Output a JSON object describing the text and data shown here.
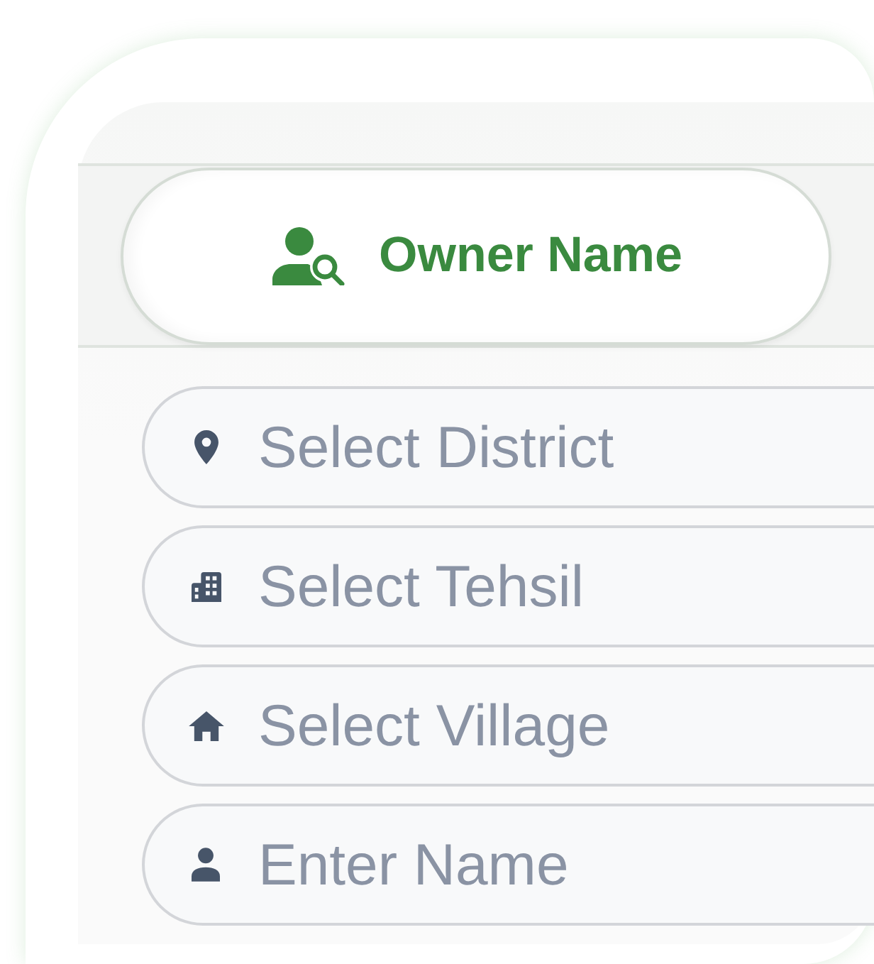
{
  "tabs": [
    {
      "label": "Owner Name",
      "selected": true
    }
  ],
  "fields": [
    {
      "placeholder": "Select District"
    },
    {
      "placeholder": "Select Tehsil"
    },
    {
      "placeholder": "Select Village"
    },
    {
      "placeholder": "Enter Name"
    }
  ]
}
